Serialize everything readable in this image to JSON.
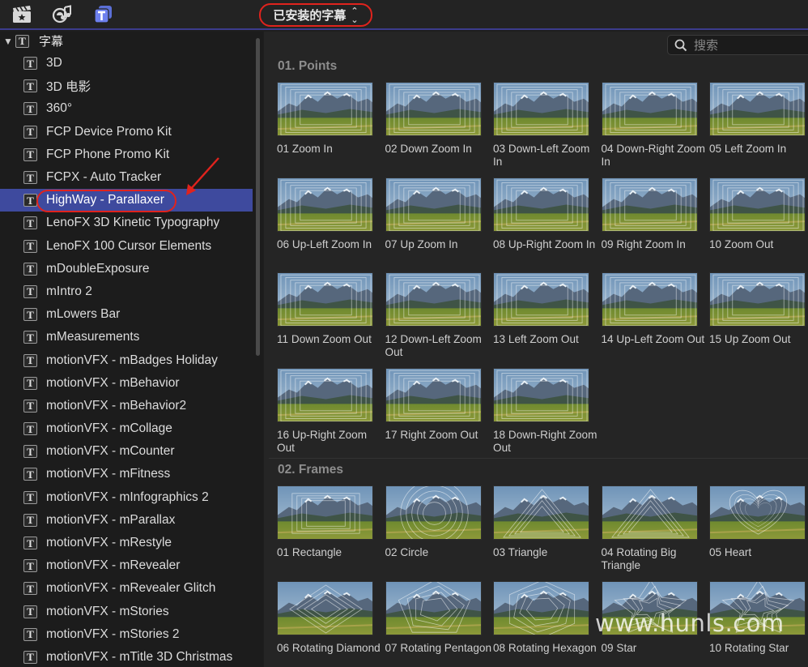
{
  "toolbar": {
    "icons": [
      "clapper-star-icon",
      "photos-music-icon",
      "titles-icon"
    ],
    "library_dropdown_label": "已安装的字幕",
    "accent": "#e0231d"
  },
  "sidebar": {
    "header": {
      "label": "字幕",
      "expanded": true
    },
    "items": [
      {
        "label": "3D"
      },
      {
        "label": "3D 电影"
      },
      {
        "label": "360°"
      },
      {
        "label": "FCP Device Promo Kit"
      },
      {
        "label": "FCP Phone Promo Kit"
      },
      {
        "label": "FCPX - Auto Tracker"
      },
      {
        "label": "HighWay - Parallaxer",
        "selected": true
      },
      {
        "label": "LenoFX 3D Kinetic Typography"
      },
      {
        "label": "LenoFX 100 Cursor Elements"
      },
      {
        "label": "mDoubleExposure"
      },
      {
        "label": "mIntro 2"
      },
      {
        "label": "mLowers Bar"
      },
      {
        "label": "mMeasurements"
      },
      {
        "label": "motionVFX - mBadges Holiday"
      },
      {
        "label": "motionVFX - mBehavior"
      },
      {
        "label": "motionVFX - mBehavior2"
      },
      {
        "label": "motionVFX - mCollage"
      },
      {
        "label": "motionVFX - mCounter"
      },
      {
        "label": "motionVFX - mFitness"
      },
      {
        "label": "motionVFX - mInfographics 2"
      },
      {
        "label": "motionVFX - mParallax"
      },
      {
        "label": "motionVFX - mRestyle"
      },
      {
        "label": "motionVFX - mRevealer"
      },
      {
        "label": "motionVFX - mRevealer Glitch"
      },
      {
        "label": "motionVFX - mStories"
      },
      {
        "label": "motionVFX - mStories 2"
      },
      {
        "label": "motionVFX - mTitle 3D Christmas"
      }
    ],
    "selected_color": "#3e4a9e"
  },
  "search": {
    "placeholder": "搜索"
  },
  "sections": [
    {
      "title": "01. Points",
      "tiles": [
        {
          "label": "01 Zoom In",
          "overlay": "zoom"
        },
        {
          "label": "02 Down Zoom In",
          "overlay": "zoom"
        },
        {
          "label": "03 Down-Left Zoom In",
          "overlay": "zoom"
        },
        {
          "label": "04 Down-Right Zoom In",
          "overlay": "zoom"
        },
        {
          "label": "05 Left Zoom In",
          "overlay": "zoom"
        },
        {
          "label": "06 Up-Left Zoom In",
          "overlay": "zoom"
        },
        {
          "label": "07 Up Zoom In",
          "overlay": "zoom"
        },
        {
          "label": "08 Up-Right Zoom In",
          "overlay": "zoom"
        },
        {
          "label": "09 Right Zoom In",
          "overlay": "zoom"
        },
        {
          "label": "10 Zoom Out",
          "overlay": "zoom"
        },
        {
          "label": "11 Down Zoom Out",
          "overlay": "zoom"
        },
        {
          "label": "12 Down-Left Zoom Out",
          "overlay": "zoom"
        },
        {
          "label": "13 Left Zoom Out",
          "overlay": "zoom"
        },
        {
          "label": "14 Up-Left Zoom Out",
          "overlay": "zoom"
        },
        {
          "label": "15 Up Zoom Out",
          "overlay": "zoom"
        },
        {
          "label": "16 Up-Right Zoom Out",
          "overlay": "zoom"
        },
        {
          "label": "17 Right Zoom Out",
          "overlay": "zoom"
        },
        {
          "label": "18 Down-Right Zoom Out",
          "overlay": "zoom"
        }
      ]
    },
    {
      "title": "02. Frames",
      "tiles": [
        {
          "label": "01 Rectangle",
          "overlay": "rect"
        },
        {
          "label": "02 Circle",
          "overlay": "circle"
        },
        {
          "label": "03 Triangle",
          "overlay": "triangle"
        },
        {
          "label": "04 Rotating Big Triangle",
          "overlay": "triangle"
        },
        {
          "label": "05 Heart",
          "overlay": "heart"
        },
        {
          "label": "06 Rotating Diamond",
          "overlay": "diamond"
        },
        {
          "label": "07 Rotating Pentagon",
          "overlay": "pentagon"
        },
        {
          "label": "08 Rotating Hexagon",
          "overlay": "hexagon"
        },
        {
          "label": "09 Star",
          "overlay": "star"
        },
        {
          "label": "10 Rotating Star",
          "overlay": "star"
        }
      ]
    }
  ],
  "watermark": "www.hunls.com"
}
